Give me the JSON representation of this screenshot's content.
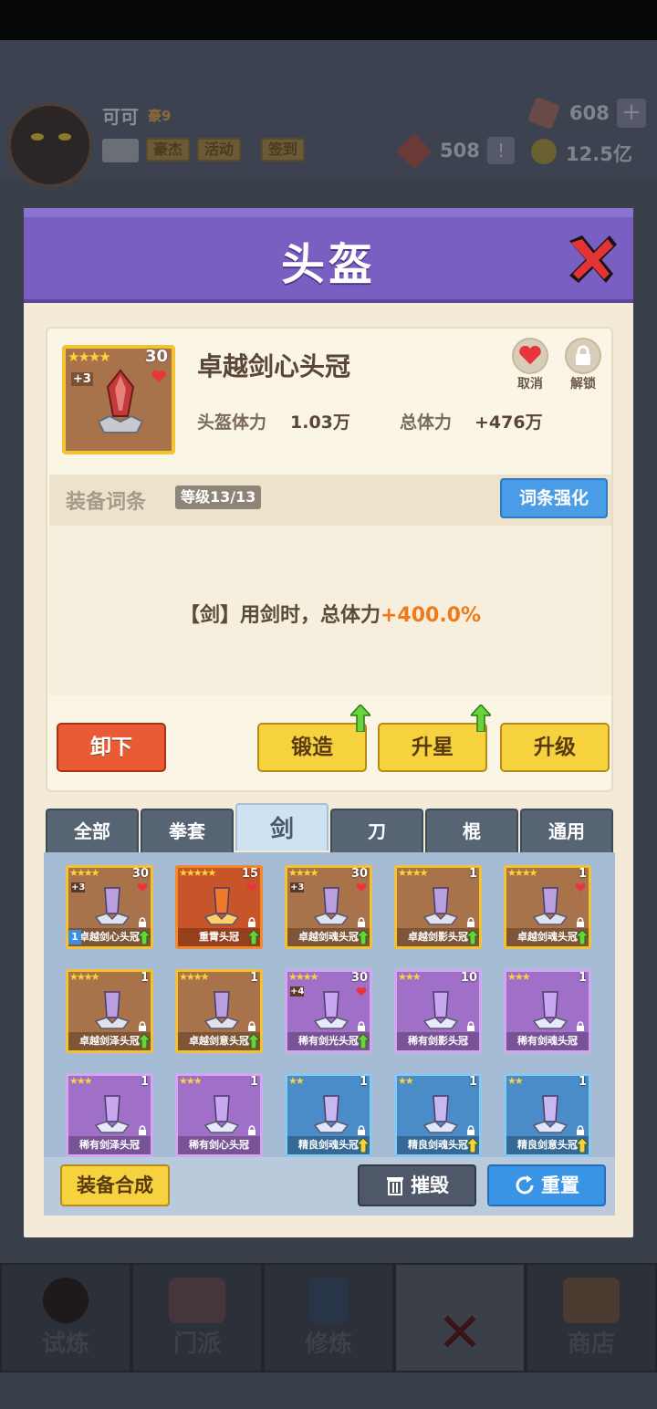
{
  "hud": {
    "player_name": "可可",
    "vip": "豪9",
    "chips": [
      "豪杰",
      "活动",
      "签到"
    ],
    "gems": "608",
    "tokens": "508",
    "gold": "12.5亿"
  },
  "dialog": {
    "title": "头盔",
    "item": {
      "name": "卓越剑心头冠",
      "stars": "★★★★",
      "level": "30",
      "plus": "+3",
      "stat1_label": "头盔体力",
      "stat1_value": "1.03万",
      "stat2_label": "总体力",
      "stat2_value": "+476万",
      "cancel_label": "取消",
      "unlock_label": "解锁"
    },
    "attributes": {
      "title": "装备词条",
      "level": "等级13/13",
      "enhance_label": "词条强化",
      "line_prefix": "【剑】用剑时，总体力",
      "line_value": "+400.0%"
    },
    "actions": {
      "unequip": "卸下",
      "forge": "锻造",
      "star_up": "升星",
      "upgrade": "升级"
    },
    "tabs": [
      "全部",
      "拳套",
      "剑",
      "刀",
      "棍",
      "通用"
    ],
    "active_tab": "剑",
    "grid": [
      {
        "name": "卓越剑心头冠",
        "stars": "★★★★",
        "level": "30",
        "quality": "gold",
        "plus": "+3",
        "heart": true,
        "badge": "1",
        "arrow": true
      },
      {
        "name": "重霄头冠",
        "stars": "★★★★★",
        "level": "15",
        "quality": "red",
        "plus": "",
        "heart": true,
        "badge": "",
        "arrow": true
      },
      {
        "name": "卓越剑魂头冠",
        "stars": "★★★★",
        "level": "30",
        "quality": "gold",
        "plus": "+3",
        "heart": true,
        "badge": "",
        "arrow": true
      },
      {
        "name": "卓越剑影头冠",
        "stars": "★★★★",
        "level": "1",
        "quality": "gold",
        "plus": "",
        "heart": false,
        "badge": "",
        "arrow": true
      },
      {
        "name": "卓越剑魂头冠",
        "stars": "★★★★",
        "level": "1",
        "quality": "gold",
        "plus": "",
        "heart": true,
        "badge": "",
        "arrow": true
      },
      {
        "name": "卓越剑泽头冠",
        "stars": "★★★★",
        "level": "1",
        "quality": "gold",
        "plus": "",
        "heart": false,
        "badge": "",
        "arrow": true
      },
      {
        "name": "卓越剑意头冠",
        "stars": "★★★★",
        "level": "1",
        "quality": "gold",
        "plus": "",
        "heart": false,
        "badge": "",
        "arrow": true
      },
      {
        "name": "稀有剑光头冠",
        "stars": "★★★★",
        "level": "30",
        "quality": "purple",
        "plus": "+4",
        "heart": true,
        "badge": "",
        "arrow": true
      },
      {
        "name": "稀有剑影头冠",
        "stars": "★★★",
        "level": "10",
        "quality": "purple",
        "plus": "",
        "heart": false,
        "badge": "",
        "arrow": false
      },
      {
        "name": "稀有剑魂头冠",
        "stars": "★★★",
        "level": "1",
        "quality": "purple",
        "plus": "",
        "heart": false,
        "badge": "",
        "arrow": false
      },
      {
        "name": "稀有剑泽头冠",
        "stars": "★★★",
        "level": "1",
        "quality": "purple",
        "plus": "",
        "heart": false,
        "badge": "",
        "arrow": false
      },
      {
        "name": "稀有剑心头冠",
        "stars": "★★★",
        "level": "1",
        "quality": "purple",
        "plus": "",
        "heart": false,
        "badge": "",
        "arrow": false
      },
      {
        "name": "精良剑魂头冠",
        "stars": "★★",
        "level": "1",
        "quality": "blue",
        "plus": "",
        "heart": false,
        "badge": "",
        "arrow": true
      },
      {
        "name": "精良剑魂头冠",
        "stars": "★★",
        "level": "1",
        "quality": "blue",
        "plus": "",
        "heart": false,
        "badge": "",
        "arrow": true
      },
      {
        "name": "精良剑意头冠",
        "stars": "★★",
        "level": "1",
        "quality": "blue",
        "plus": "",
        "heart": false,
        "badge": "",
        "arrow": true
      }
    ],
    "footer": {
      "synthesize": "装备合成",
      "destroy": "摧毁",
      "reset": "重置"
    }
  },
  "bottom_nav": [
    "试炼",
    "门派",
    "修炼",
    "",
    "商店"
  ]
}
